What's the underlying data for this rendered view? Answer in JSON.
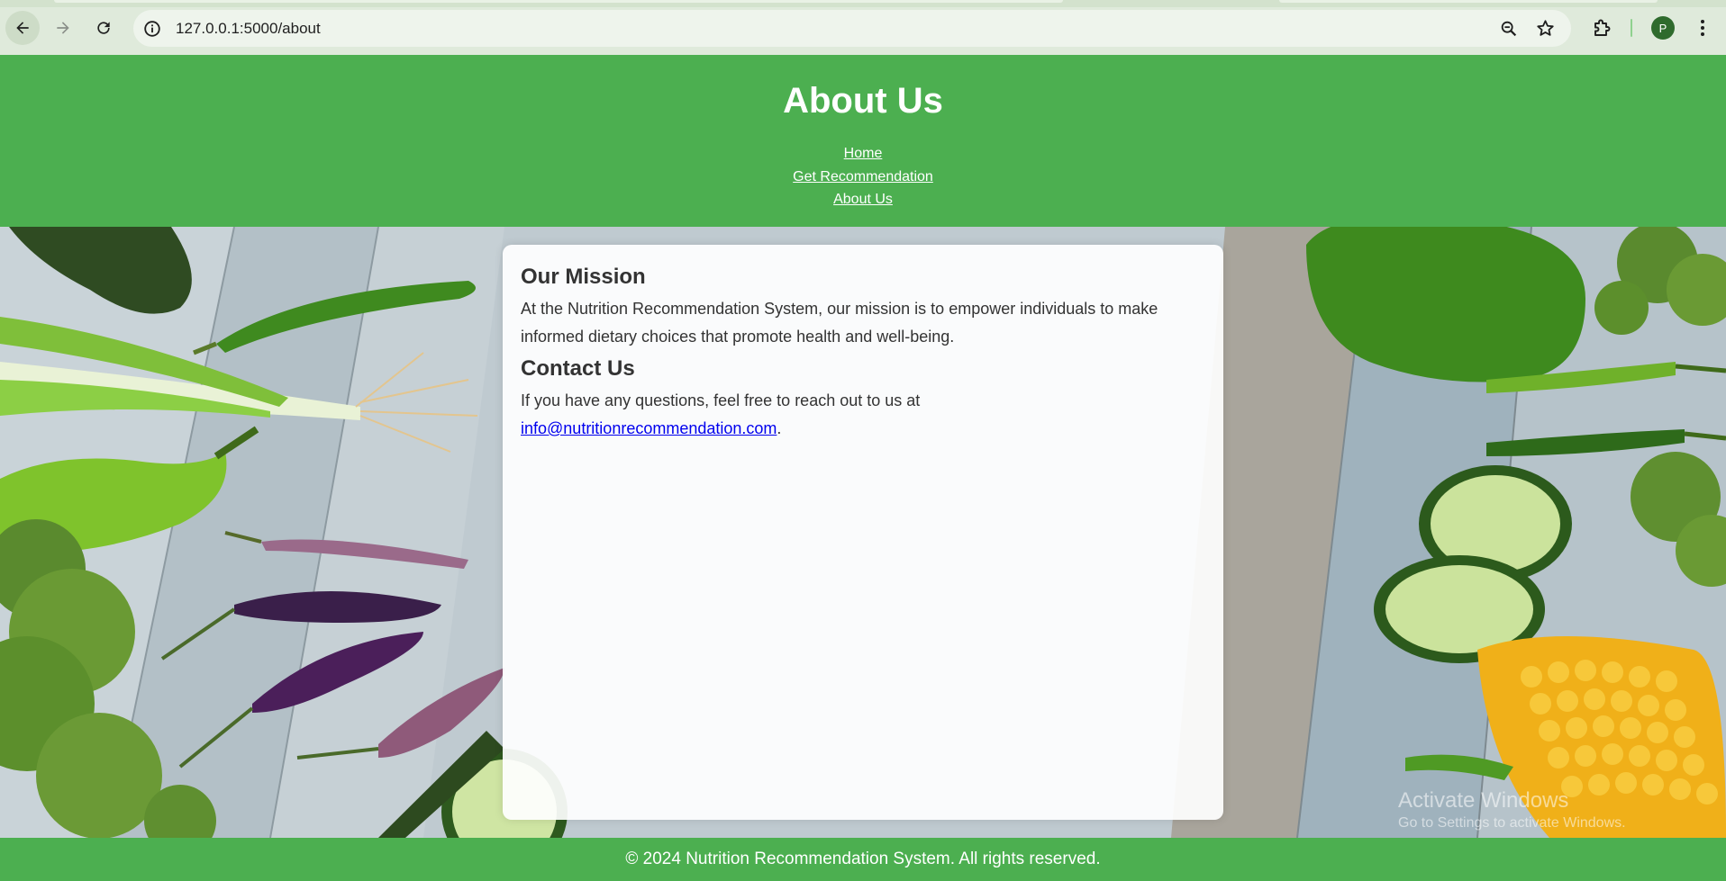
{
  "browser": {
    "url": "127.0.0.1:5000/about",
    "profile_initial": "P"
  },
  "header": {
    "title": "About Us",
    "nav": [
      {
        "label": "Home"
      },
      {
        "label": "Get Recommendation"
      },
      {
        "label": "About Us"
      }
    ]
  },
  "main": {
    "mission": {
      "heading": "Our Mission",
      "text": "At the Nutrition Recommendation System, our mission is to empower individuals to make informed dietary choices that promote health and well-being."
    },
    "contact": {
      "heading": "Contact Us",
      "text_before": "If you have any questions, feel free to reach out to us at",
      "email": "info@nutritionrecommendation.com",
      "text_after": "."
    }
  },
  "watermark": {
    "line1": "Activate Windows",
    "line2": "Go to Settings to activate Windows."
  },
  "footer": {
    "text": "© 2024 Nutrition Recommendation System. All rights reserved."
  },
  "colors": {
    "brand_green": "#4caf50",
    "chrome_bg": "#dfeadb",
    "link_blue": "#0000ee"
  }
}
